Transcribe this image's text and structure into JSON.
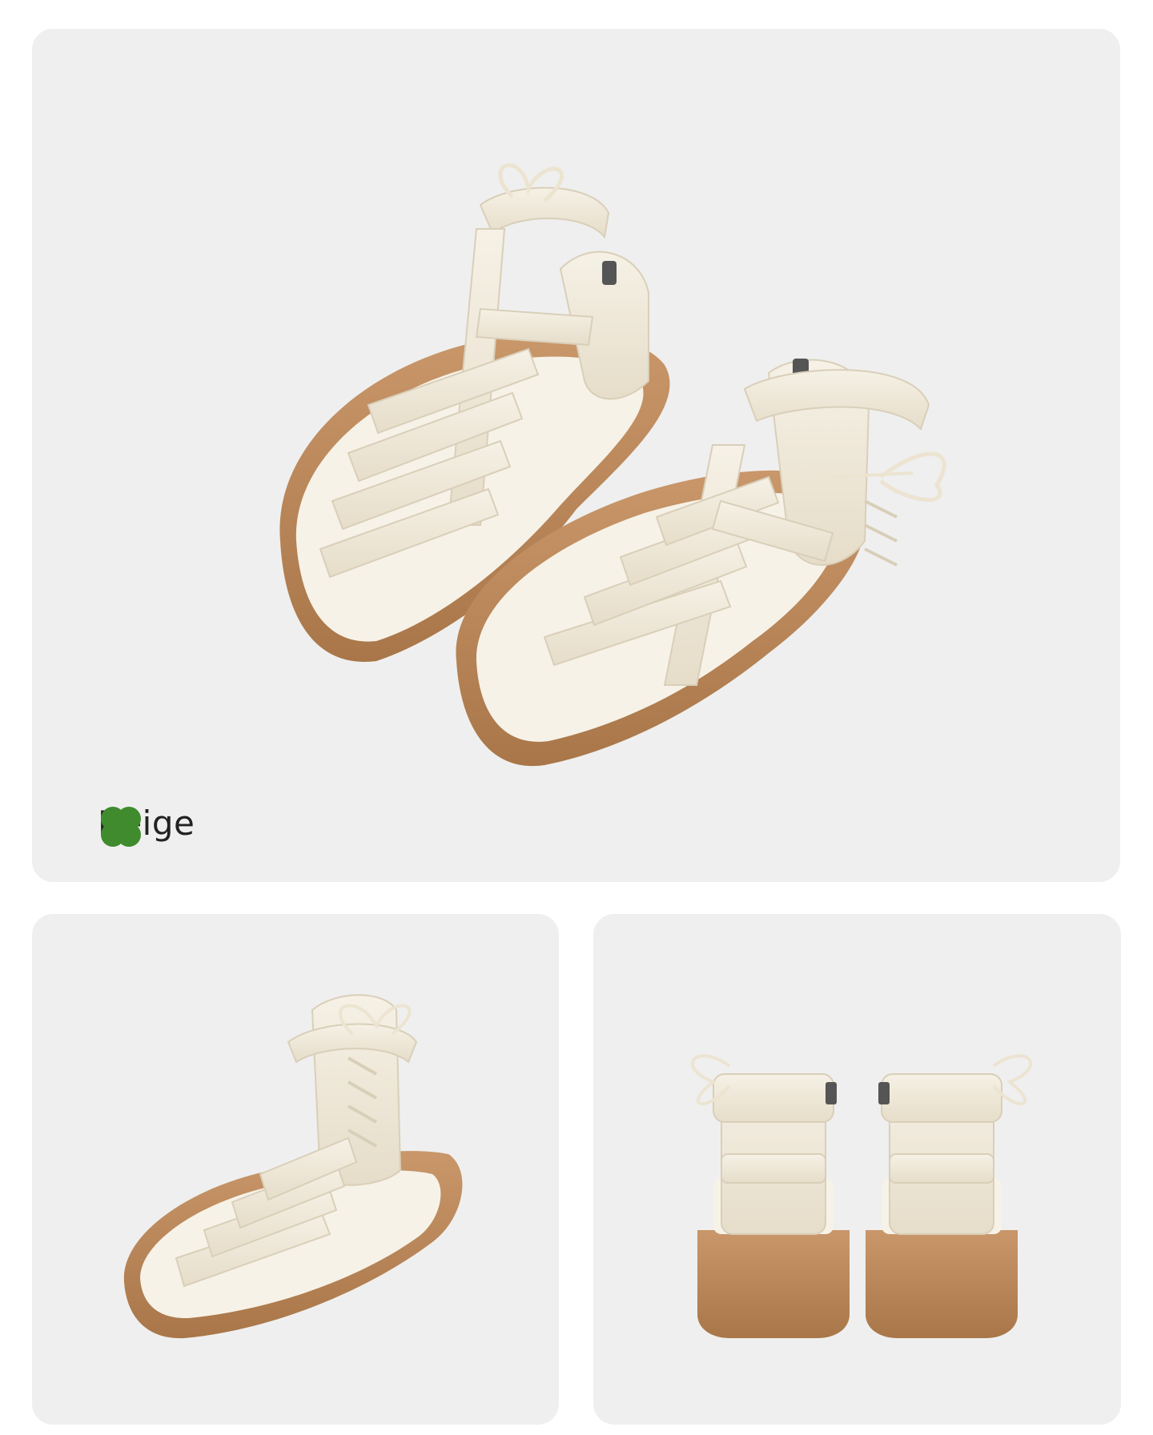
{
  "color_option": {
    "name": "Beige",
    "icon": "clover-icon",
    "icon_color": "#3f8b2d"
  },
  "colors": {
    "panel_background": "#efefef",
    "strap": "#f1ebdd",
    "sole": "#b8865a",
    "footbed": "#f7f2e8"
  }
}
